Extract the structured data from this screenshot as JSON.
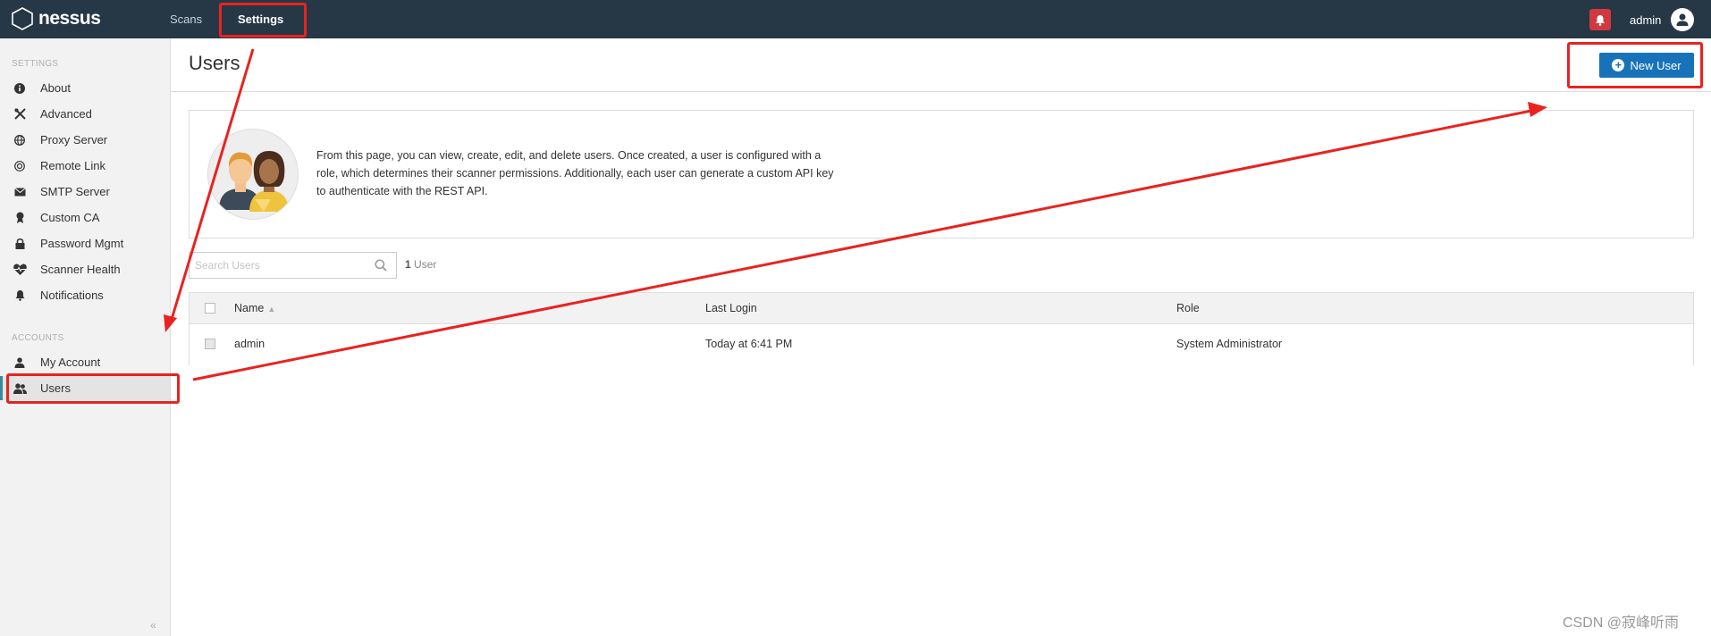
{
  "topbar": {
    "logo_text": "nessus",
    "nav_scans": "Scans",
    "nav_settings": "Settings",
    "username": "admin",
    "icons": {
      "logo": "hexagon-logo-icon",
      "notifications": "bell-icon",
      "avatar": "user-avatar-icon"
    },
    "background_color": "#263746",
    "bell_color": "#d0393e"
  },
  "sidebar": {
    "settings_heading": "SETTINGS",
    "settings_items": [
      {
        "label": "About",
        "icon": "info-icon"
      },
      {
        "label": "Advanced",
        "icon": "tools-icon"
      },
      {
        "label": "Proxy Server",
        "icon": "globe-icon"
      },
      {
        "label": "Remote Link",
        "icon": "link-icon"
      },
      {
        "label": "SMTP Server",
        "icon": "envelope-icon"
      },
      {
        "label": "Custom CA",
        "icon": "certificate-icon"
      },
      {
        "label": "Password Mgmt",
        "icon": "lock-icon"
      },
      {
        "label": "Scanner Health",
        "icon": "heartbeat-icon"
      },
      {
        "label": "Notifications",
        "icon": "bell-icon"
      }
    ],
    "accounts_heading": "ACCOUNTS",
    "account_items": [
      {
        "label": "My Account",
        "icon": "user-icon"
      },
      {
        "label": "Users",
        "icon": "users-icon"
      }
    ],
    "active_item": "Users",
    "collapse_glyph": "«"
  },
  "main": {
    "title": "Users",
    "new_user_label": "New User",
    "info_text": "From this page, you can view, create, edit, and delete users. Once created, a user is configured with a role, which determines their scanner permissions. Additionally, each user can generate a custom API key to authenticate with the REST API.",
    "search_placeholder": "Search Users",
    "count_number": "1",
    "count_label": " User",
    "accent_color": "#1872b9"
  },
  "table": {
    "columns": [
      "Name",
      "Last Login",
      "Role"
    ],
    "sort_indicator": "▲",
    "rows": [
      {
        "name": "admin",
        "last_login": "Today at 6:41 PM",
        "role": "System Administrator"
      }
    ]
  },
  "annotations": {
    "color": "#e8231f"
  },
  "watermark": "CSDN @寂峰听雨"
}
